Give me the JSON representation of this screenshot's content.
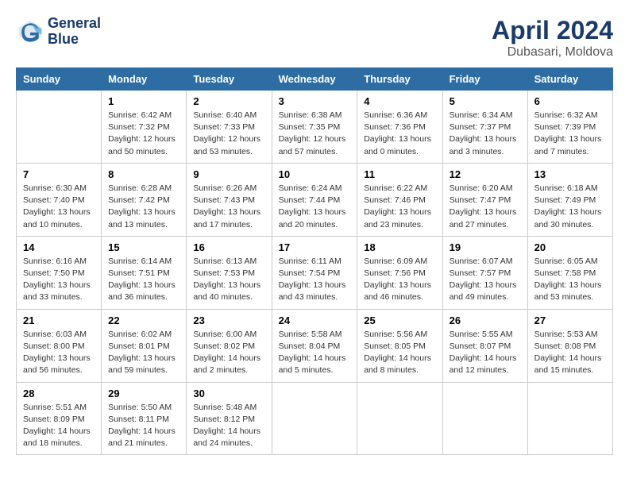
{
  "header": {
    "logo_line1": "General",
    "logo_line2": "Blue",
    "month": "April 2024",
    "location": "Dubasari, Moldova"
  },
  "weekdays": [
    "Sunday",
    "Monday",
    "Tuesday",
    "Wednesday",
    "Thursday",
    "Friday",
    "Saturday"
  ],
  "weeks": [
    [
      {
        "day": "",
        "info": ""
      },
      {
        "day": "1",
        "info": "Sunrise: 6:42 AM\nSunset: 7:32 PM\nDaylight: 12 hours\nand 50 minutes."
      },
      {
        "day": "2",
        "info": "Sunrise: 6:40 AM\nSunset: 7:33 PM\nDaylight: 12 hours\nand 53 minutes."
      },
      {
        "day": "3",
        "info": "Sunrise: 6:38 AM\nSunset: 7:35 PM\nDaylight: 12 hours\nand 57 minutes."
      },
      {
        "day": "4",
        "info": "Sunrise: 6:36 AM\nSunset: 7:36 PM\nDaylight: 13 hours\nand 0 minutes."
      },
      {
        "day": "5",
        "info": "Sunrise: 6:34 AM\nSunset: 7:37 PM\nDaylight: 13 hours\nand 3 minutes."
      },
      {
        "day": "6",
        "info": "Sunrise: 6:32 AM\nSunset: 7:39 PM\nDaylight: 13 hours\nand 7 minutes."
      }
    ],
    [
      {
        "day": "7",
        "info": "Sunrise: 6:30 AM\nSunset: 7:40 PM\nDaylight: 13 hours\nand 10 minutes."
      },
      {
        "day": "8",
        "info": "Sunrise: 6:28 AM\nSunset: 7:42 PM\nDaylight: 13 hours\nand 13 minutes."
      },
      {
        "day": "9",
        "info": "Sunrise: 6:26 AM\nSunset: 7:43 PM\nDaylight: 13 hours\nand 17 minutes."
      },
      {
        "day": "10",
        "info": "Sunrise: 6:24 AM\nSunset: 7:44 PM\nDaylight: 13 hours\nand 20 minutes."
      },
      {
        "day": "11",
        "info": "Sunrise: 6:22 AM\nSunset: 7:46 PM\nDaylight: 13 hours\nand 23 minutes."
      },
      {
        "day": "12",
        "info": "Sunrise: 6:20 AM\nSunset: 7:47 PM\nDaylight: 13 hours\nand 27 minutes."
      },
      {
        "day": "13",
        "info": "Sunrise: 6:18 AM\nSunset: 7:49 PM\nDaylight: 13 hours\nand 30 minutes."
      }
    ],
    [
      {
        "day": "14",
        "info": "Sunrise: 6:16 AM\nSunset: 7:50 PM\nDaylight: 13 hours\nand 33 minutes."
      },
      {
        "day": "15",
        "info": "Sunrise: 6:14 AM\nSunset: 7:51 PM\nDaylight: 13 hours\nand 36 minutes."
      },
      {
        "day": "16",
        "info": "Sunrise: 6:13 AM\nSunset: 7:53 PM\nDaylight: 13 hours\nand 40 minutes."
      },
      {
        "day": "17",
        "info": "Sunrise: 6:11 AM\nSunset: 7:54 PM\nDaylight: 13 hours\nand 43 minutes."
      },
      {
        "day": "18",
        "info": "Sunrise: 6:09 AM\nSunset: 7:56 PM\nDaylight: 13 hours\nand 46 minutes."
      },
      {
        "day": "19",
        "info": "Sunrise: 6:07 AM\nSunset: 7:57 PM\nDaylight: 13 hours\nand 49 minutes."
      },
      {
        "day": "20",
        "info": "Sunrise: 6:05 AM\nSunset: 7:58 PM\nDaylight: 13 hours\nand 53 minutes."
      }
    ],
    [
      {
        "day": "21",
        "info": "Sunrise: 6:03 AM\nSunset: 8:00 PM\nDaylight: 13 hours\nand 56 minutes."
      },
      {
        "day": "22",
        "info": "Sunrise: 6:02 AM\nSunset: 8:01 PM\nDaylight: 13 hours\nand 59 minutes."
      },
      {
        "day": "23",
        "info": "Sunrise: 6:00 AM\nSunset: 8:02 PM\nDaylight: 14 hours\nand 2 minutes."
      },
      {
        "day": "24",
        "info": "Sunrise: 5:58 AM\nSunset: 8:04 PM\nDaylight: 14 hours\nand 5 minutes."
      },
      {
        "day": "25",
        "info": "Sunrise: 5:56 AM\nSunset: 8:05 PM\nDaylight: 14 hours\nand 8 minutes."
      },
      {
        "day": "26",
        "info": "Sunrise: 5:55 AM\nSunset: 8:07 PM\nDaylight: 14 hours\nand 12 minutes."
      },
      {
        "day": "27",
        "info": "Sunrise: 5:53 AM\nSunset: 8:08 PM\nDaylight: 14 hours\nand 15 minutes."
      }
    ],
    [
      {
        "day": "28",
        "info": "Sunrise: 5:51 AM\nSunset: 8:09 PM\nDaylight: 14 hours\nand 18 minutes."
      },
      {
        "day": "29",
        "info": "Sunrise: 5:50 AM\nSunset: 8:11 PM\nDaylight: 14 hours\nand 21 minutes."
      },
      {
        "day": "30",
        "info": "Sunrise: 5:48 AM\nSunset: 8:12 PM\nDaylight: 14 hours\nand 24 minutes."
      },
      {
        "day": "",
        "info": ""
      },
      {
        "day": "",
        "info": ""
      },
      {
        "day": "",
        "info": ""
      },
      {
        "day": "",
        "info": ""
      }
    ]
  ]
}
